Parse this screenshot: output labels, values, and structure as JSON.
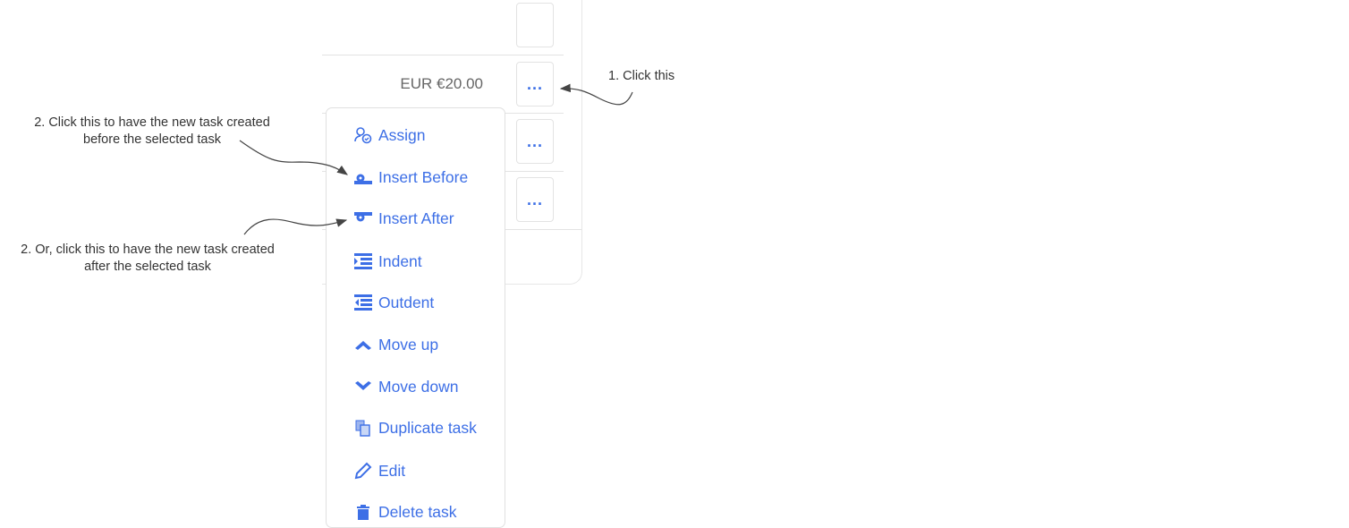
{
  "table": {
    "rows": [
      {
        "price": "",
        "menu_button": "..."
      },
      {
        "price": "EUR €20.00",
        "menu_button": "..."
      },
      {
        "price": "",
        "menu_button": "..."
      },
      {
        "price": "",
        "menu_button": "..."
      }
    ]
  },
  "context_menu": {
    "items": [
      {
        "label": "Assign",
        "icon": "assign-user-icon"
      },
      {
        "label": "Insert Before",
        "icon": "insert-before-icon"
      },
      {
        "label": "Insert After",
        "icon": "insert-after-icon"
      },
      {
        "label": "Indent",
        "icon": "indent-icon"
      },
      {
        "label": "Outdent",
        "icon": "outdent-icon"
      },
      {
        "label": "Move up",
        "icon": "chevron-up-icon"
      },
      {
        "label": "Move down",
        "icon": "chevron-down-icon"
      },
      {
        "label": "Duplicate task",
        "icon": "duplicate-icon"
      },
      {
        "label": "Edit",
        "icon": "pencil-icon"
      },
      {
        "label": "Delete task",
        "icon": "trash-icon"
      }
    ]
  },
  "annotations": {
    "step1": "1. Click this",
    "step2_before_line1": "2. Click this to have the new task created",
    "step2_before_line2": "before the selected task",
    "step2_after_line1": "2. Or, click this to have the new task created",
    "step2_after_line2": "after the selected task"
  },
  "colors": {
    "accent": "#3d6fe6",
    "text_muted": "#666666",
    "annotation": "#333333"
  }
}
